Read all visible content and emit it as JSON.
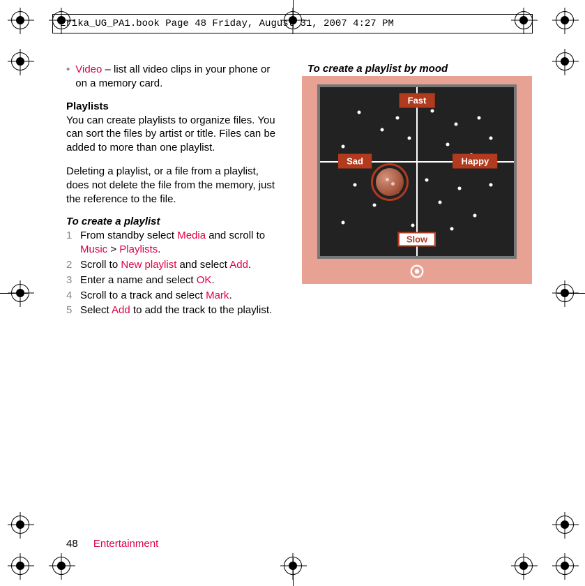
{
  "header": {
    "meta": "Erika_UG_PA1.book  Page 48  Friday, August 31, 2007  4:27 PM"
  },
  "left": {
    "bullet_term": "Video",
    "bullet_rest": " – list all video clips in your phone or on a memory card.",
    "playlists_h": "Playlists",
    "playlists_p1": "You can create playlists to organize files. You can sort the files by artist or title. Files can be added to more than one playlist.",
    "playlists_p2": "Deleting a playlist, or a file from a playlist, does not delete the file from the memory, just the reference to the file.",
    "create_h": "To create a playlist",
    "steps": [
      {
        "n": "1",
        "pre": "From standby select ",
        "r1": "Media",
        "mid1": " and scroll to ",
        "r2": "Music",
        "mid2": " > ",
        "r3": "Playlists",
        "post": "."
      },
      {
        "n": "2",
        "pre": "Scroll to ",
        "r1": "New playlist",
        "mid1": " and select ",
        "r2": "Add",
        "post": "."
      },
      {
        "n": "3",
        "pre": "Enter a name and select ",
        "r1": "OK",
        "post": "."
      },
      {
        "n": "4",
        "pre": "Scroll to a track and select ",
        "r1": "Mark",
        "post": "."
      },
      {
        "n": "5",
        "pre": "Select ",
        "r1": "Add",
        "mid1": " to add the track to the playlist.",
        "post": ""
      }
    ]
  },
  "right": {
    "heading": "To create a playlist by mood",
    "labels": {
      "top": "Fast",
      "bottom": "Slow",
      "left": "Sad",
      "right": "Happy"
    }
  },
  "footer": {
    "page": "48",
    "section": "Entertainment"
  }
}
